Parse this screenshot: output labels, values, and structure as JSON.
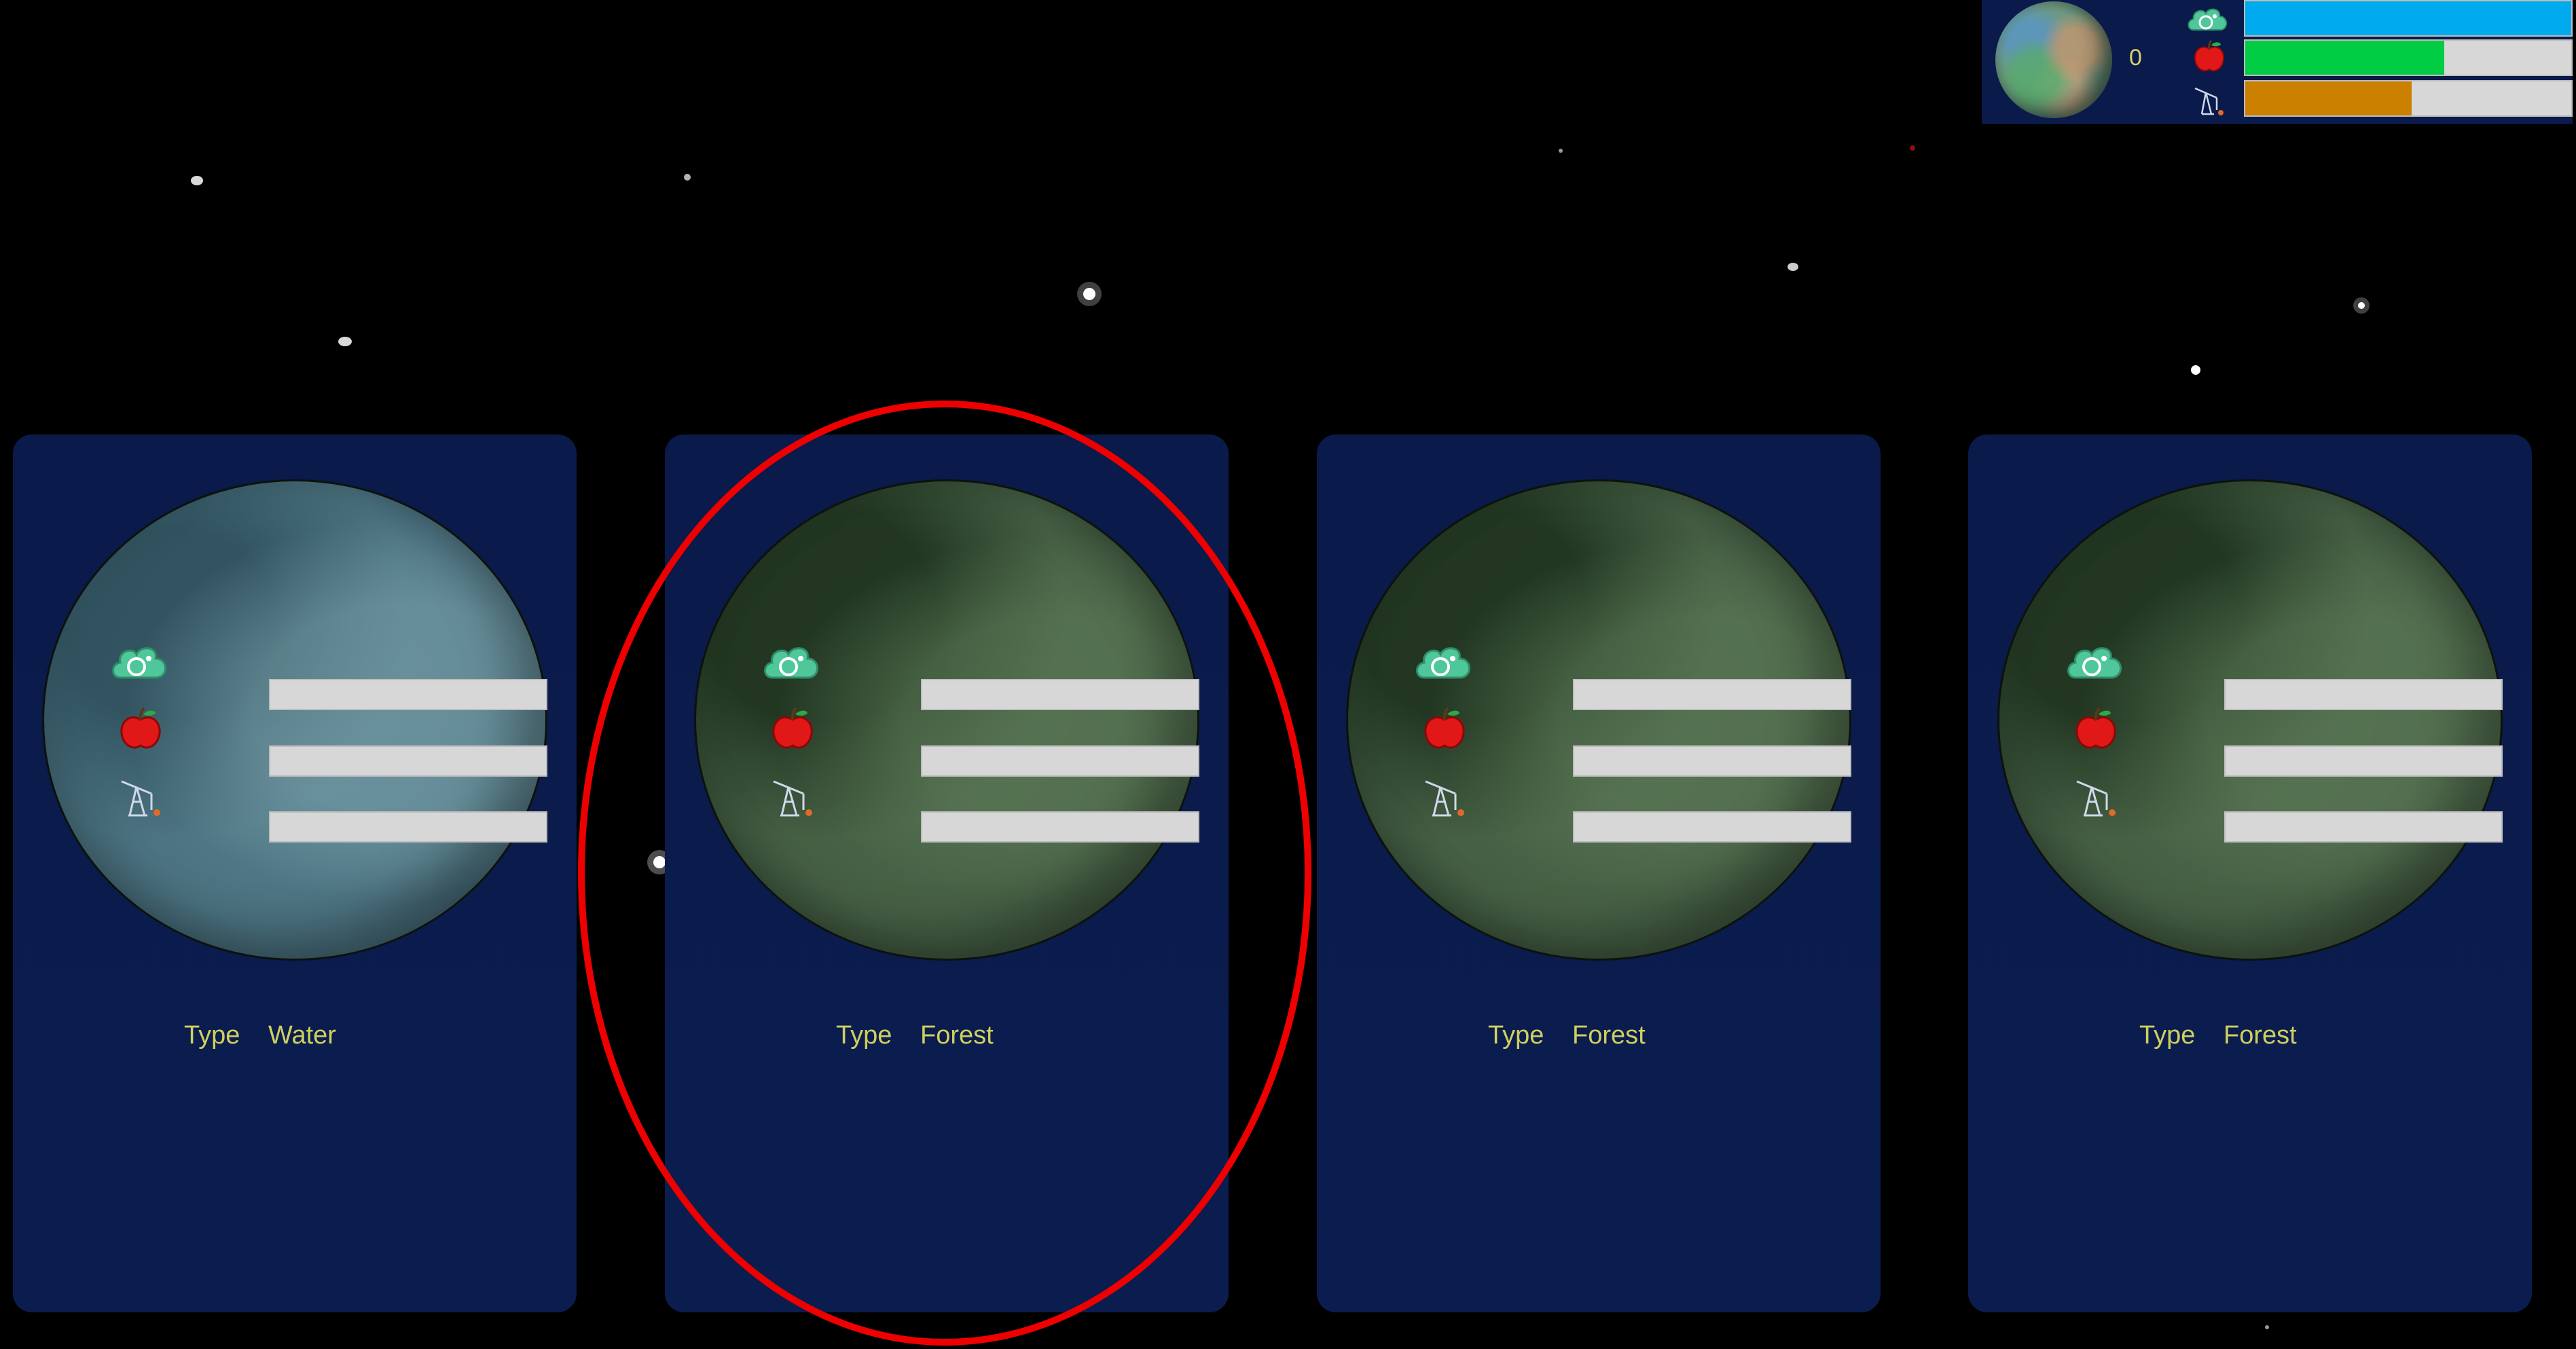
{
  "colors": {
    "background": "#000000",
    "panel": "#0a1a4a",
    "text": "#cfcf5e",
    "oxygen_bar": "#00aaee",
    "food_bar": "#00cc44",
    "mineral_bar": "#cc8000",
    "bar_empty": "#d7d7d7",
    "highlight": "#ee0000"
  },
  "hud": {
    "count": "0",
    "resources": [
      {
        "name": "oxygen",
        "icon": "oxygen-cloud-icon",
        "fill": 1.0
      },
      {
        "name": "food",
        "icon": "apple-icon",
        "fill": 0.61
      },
      {
        "name": "minerals",
        "icon": "oil-pump-icon",
        "fill": 0.51
      }
    ]
  },
  "cards": [
    {
      "type_label": "Type",
      "type_value": "Water",
      "planet_style": "water",
      "resources": [
        {
          "icon": "oxygen-cloud-icon",
          "fill": 0.0
        },
        {
          "icon": "apple-icon",
          "fill": 0.0
        },
        {
          "icon": "oil-pump-icon",
          "fill": 0.0
        }
      ]
    },
    {
      "type_label": "Type",
      "type_value": "Forest",
      "planet_style": "forest",
      "highlighted": true,
      "resources": [
        {
          "icon": "oxygen-cloud-icon",
          "fill": 0.0
        },
        {
          "icon": "apple-icon",
          "fill": 0.0
        },
        {
          "icon": "oil-pump-icon",
          "fill": 0.0
        }
      ]
    },
    {
      "type_label": "Type",
      "type_value": "Forest",
      "planet_style": "forest",
      "resources": [
        {
          "icon": "oxygen-cloud-icon",
          "fill": 0.0
        },
        {
          "icon": "apple-icon",
          "fill": 0.0
        },
        {
          "icon": "oil-pump-icon",
          "fill": 0.0
        }
      ]
    },
    {
      "type_label": "Type",
      "type_value": "Forest",
      "planet_style": "forest",
      "resources": [
        {
          "icon": "oxygen-cloud-icon",
          "fill": 0.0
        },
        {
          "icon": "apple-icon",
          "fill": 0.0
        },
        {
          "icon": "oil-pump-icon",
          "fill": 0.0
        }
      ]
    }
  ]
}
